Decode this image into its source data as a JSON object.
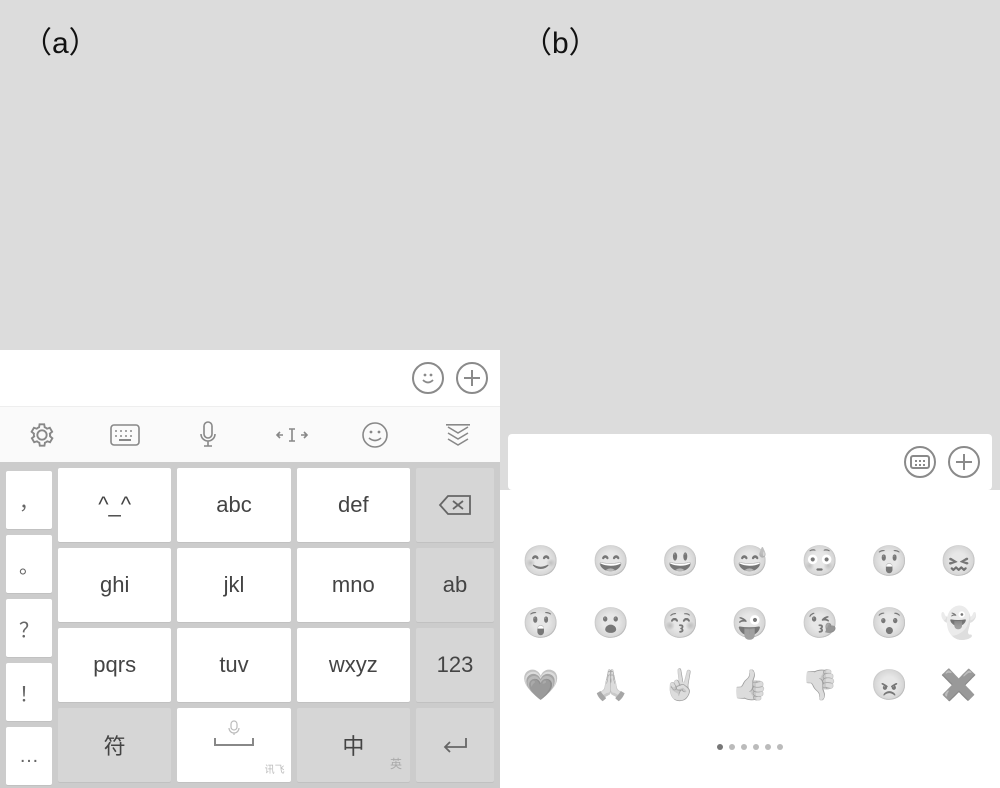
{
  "panelA": {
    "label": "（a）"
  },
  "panelB": {
    "label": "（b）"
  },
  "inputBarA": {
    "value": ""
  },
  "inputBarB": {
    "value": ""
  },
  "toolbar": [
    "settings",
    "keyboard-switch",
    "voice",
    "cursor-move",
    "emoji",
    "collapse"
  ],
  "keyboard": {
    "punct": [
      "，",
      "。",
      "？",
      "！",
      "…"
    ],
    "rows": [
      [
        "^_^",
        "abc",
        "def"
      ],
      [
        "ghi",
        "jkl",
        "mno"
      ],
      [
        "pqrs",
        "tuv",
        "wxyz"
      ]
    ],
    "side": [
      "backspace",
      "ab",
      "123",
      "enter"
    ],
    "bottom": {
      "symbol": "符",
      "lang_main": "中",
      "lang_sub": "英"
    },
    "ime_brand": "讯飞"
  },
  "emoji": {
    "rows": [
      [
        "😊",
        "😄",
        "😃",
        "😅",
        "😳",
        "😲",
        "😖"
      ],
      [
        "😲",
        "😮",
        "😚",
        "😜",
        "😘",
        "😯",
        "👻"
      ],
      [
        "💗",
        "🙏",
        "✌️",
        "👍",
        "👎",
        "😠",
        "✖️"
      ]
    ],
    "pages": 6,
    "activePage": 0
  }
}
